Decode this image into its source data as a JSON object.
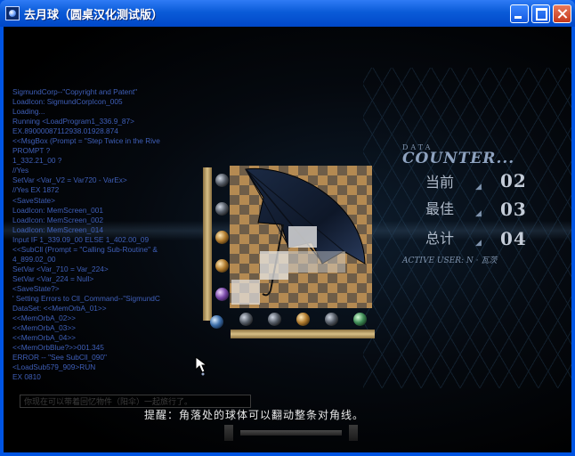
{
  "window": {
    "title": "去月球（圆桌汉化测试版）",
    "buttons": [
      "minimize",
      "maximize",
      "close"
    ]
  },
  "console": {
    "lines": [
      "SigmundCorp--\"Copyright and Patent\"",
      "LoadIcon: SigmundCorpIcon_005",
      "Loading...",
      "Running <LoadProgram1_336.9_87>",
      "EX.89000087112938.01928.874",
      "<<MsgBox (Prompt = \"Step Twice in the Rive",
      "PROMPT ?",
      "  1_332.21_00 ?",
      "  //Yes",
      "SetVar <Var_V2 = Var720 - VarEx>",
      "  //Yes    EX 1872",
      "<SaveState>",
      "LoadIcon: MemScreen_001",
      "LoadIcon: MemScreen_002",
      "LoadIcon: MemScreen_014",
      "Input IF 1_339.09_00 ELSE 1_402.00_09",
      "<<SubCll (Prompt = \"Calling Sub-Routine\" &",
      "  4_899.02_00",
      "SetVar <Var_710 = Var_224>",
      "SetVar <Var_224 = Null>",
      "<SaveState?>",
      "' Setting Errors to Cll_Command--\"SigmundC",
      "DataSet: <<MemOrbA_01>>",
      "  <<MemOrbA_02>>",
      "  <<MemOrbA_03>>",
      "  <<MemOrbA_04>>",
      "  <<MemOrbBlue?>>001.345",
      "ERROR -- \"See SubCll_090\"",
      "<LoadSub579_909>RUN",
      "EX 0810"
    ]
  },
  "counter": {
    "header": "DATA",
    "title": "COUNTER...",
    "rows": [
      {
        "label": "当前",
        "value": "02"
      },
      {
        "label": "最佳",
        "value": "03"
      },
      {
        "label": "总计",
        "value": "04"
      }
    ],
    "active_user": "ACTIVE USER: N · 瓦茨"
  },
  "hint": "你现在可以带着回忆物件（阳伞）一起旅行了。",
  "tip": "提醒：角落处的球体可以翻动整条对角线。",
  "icons": [
    "app-icon",
    "minimize-icon",
    "maximize-icon",
    "close-icon",
    "memory-orb-icon",
    "mouse-cursor-icon"
  ]
}
